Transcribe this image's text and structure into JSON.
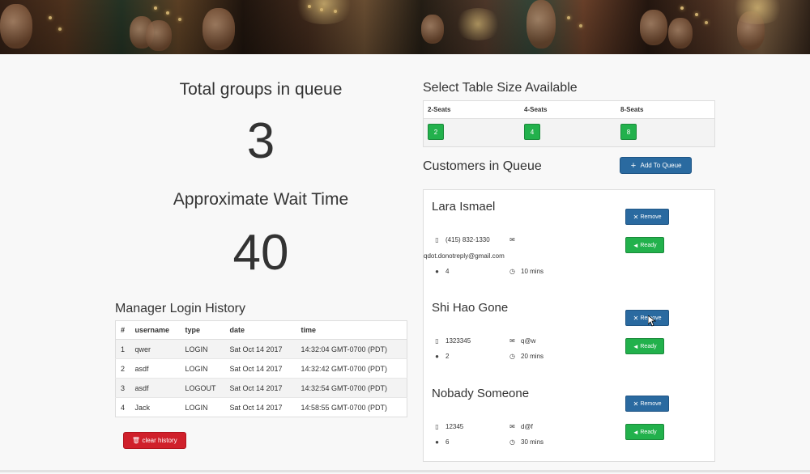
{
  "stats": {
    "groups_label": "Total groups in queue",
    "groups_value": "3",
    "wait_label": "Approximate Wait Time",
    "wait_value": "40"
  },
  "history": {
    "title": "Manager Login History",
    "columns": [
      "#",
      "username",
      "type",
      "date",
      "time"
    ],
    "rows": [
      [
        "1",
        "qwer",
        "LOGIN",
        "Sat Oct 14 2017",
        "14:32:04 GMT-0700 (PDT)"
      ],
      [
        "2",
        "asdf",
        "LOGIN",
        "Sat Oct 14 2017",
        "14:32:42 GMT-0700 (PDT)"
      ],
      [
        "3",
        "asdf",
        "LOGOUT",
        "Sat Oct 14 2017",
        "14:32:54 GMT-0700 (PDT)"
      ],
      [
        "4",
        "Jack",
        "LOGIN",
        "Sat Oct 14 2017",
        "14:58:55 GMT-0700 (PDT)"
      ]
    ],
    "clear_label": "clear history"
  },
  "tables": {
    "title": "Select Table Size Available",
    "columns": [
      {
        "label": "2-Seats",
        "count": "2"
      },
      {
        "label": "4-Seats",
        "count": "4"
      },
      {
        "label": "8-Seats",
        "count": "8"
      }
    ]
  },
  "queue": {
    "title": "Customers in Queue",
    "add_label": "Add To Queue",
    "remove_label": "Remove",
    "ready_label": "Ready",
    "customers": [
      {
        "name": "Lara Ismael",
        "phone": "(415) 832-1330",
        "email": "qdot.donotreply@gmail.com",
        "party": "4",
        "wait": "10 mins"
      },
      {
        "name": "Shi Hao Gone",
        "phone": "1323345",
        "email": "q@w",
        "party": "2",
        "wait": "20 mins"
      },
      {
        "name": "Nobady Someone",
        "phone": "12345",
        "email": "d@f",
        "party": "6",
        "wait": "30 mins"
      }
    ]
  },
  "colors": {
    "primary": "#2a6aa0",
    "success": "#22b14c",
    "danger": "#d0202b"
  }
}
